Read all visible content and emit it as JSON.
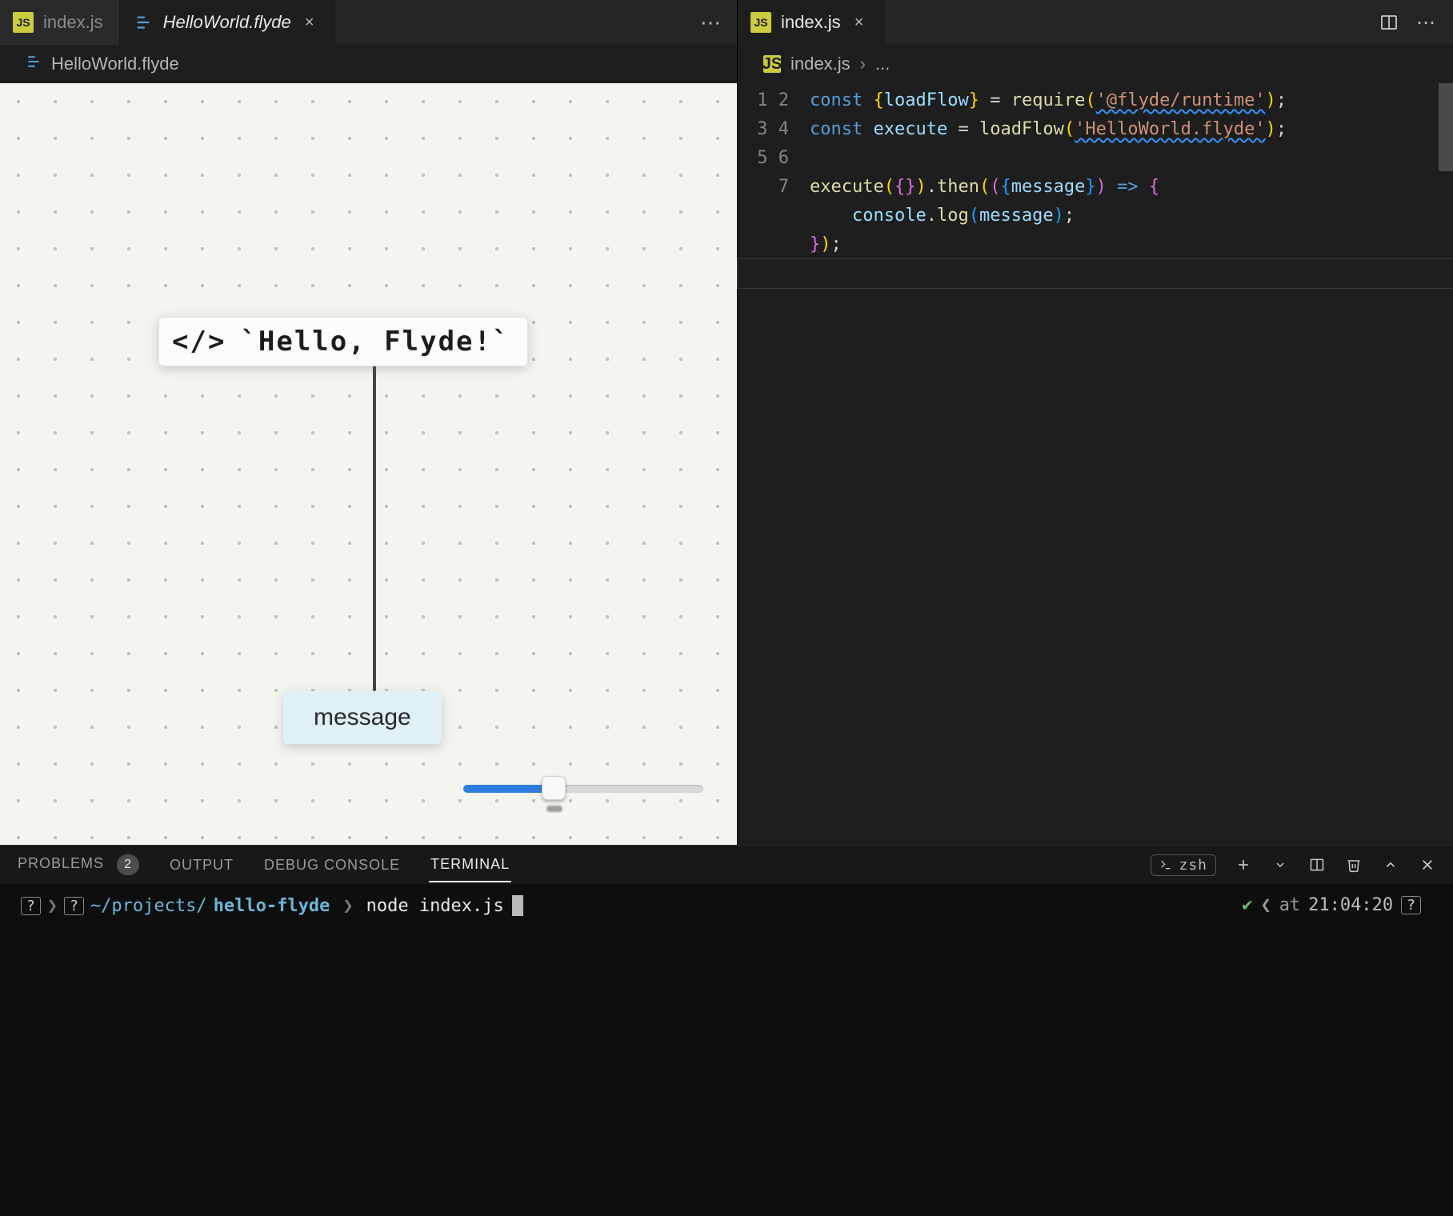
{
  "left": {
    "tabs": [
      {
        "label": "index.js",
        "type": "js",
        "active": false
      },
      {
        "label": "HelloWorld.flyde",
        "type": "flyde",
        "active": true,
        "closeable": true,
        "italic": true
      }
    ],
    "breadcrumb": "HelloWorld.flyde",
    "node_text": "`Hello, Flyde!`",
    "output_label": "message"
  },
  "right": {
    "tabs": [
      {
        "label": "index.js",
        "type": "js",
        "active": true,
        "closeable": true
      }
    ],
    "breadcrumb": {
      "file": "index.js",
      "rest": "..."
    },
    "code": {
      "line_count": 7,
      "tokens": {
        "const": "const",
        "loadFlow": "loadFlow",
        "require": "require",
        "require_arg": "'@flyde/runtime'",
        "execute": "execute",
        "loadFlow_arg": "'HelloWorld.flyde'",
        "then": "then",
        "message": "message",
        "arrow": "=>",
        "console": "console",
        "log": "log"
      }
    }
  },
  "panel": {
    "tabs": {
      "problems": "PROBLEMS",
      "problems_count": "2",
      "output": "OUTPUT",
      "debug": "DEBUG CONSOLE",
      "terminal": "TERMINAL"
    },
    "shell_label": "zsh",
    "prompt": {
      "path_prefix": "~/projects/",
      "folder": "hello-flyde",
      "command": "node index.js"
    },
    "right_status": {
      "prefix": "at",
      "time": "21:04:20"
    }
  }
}
